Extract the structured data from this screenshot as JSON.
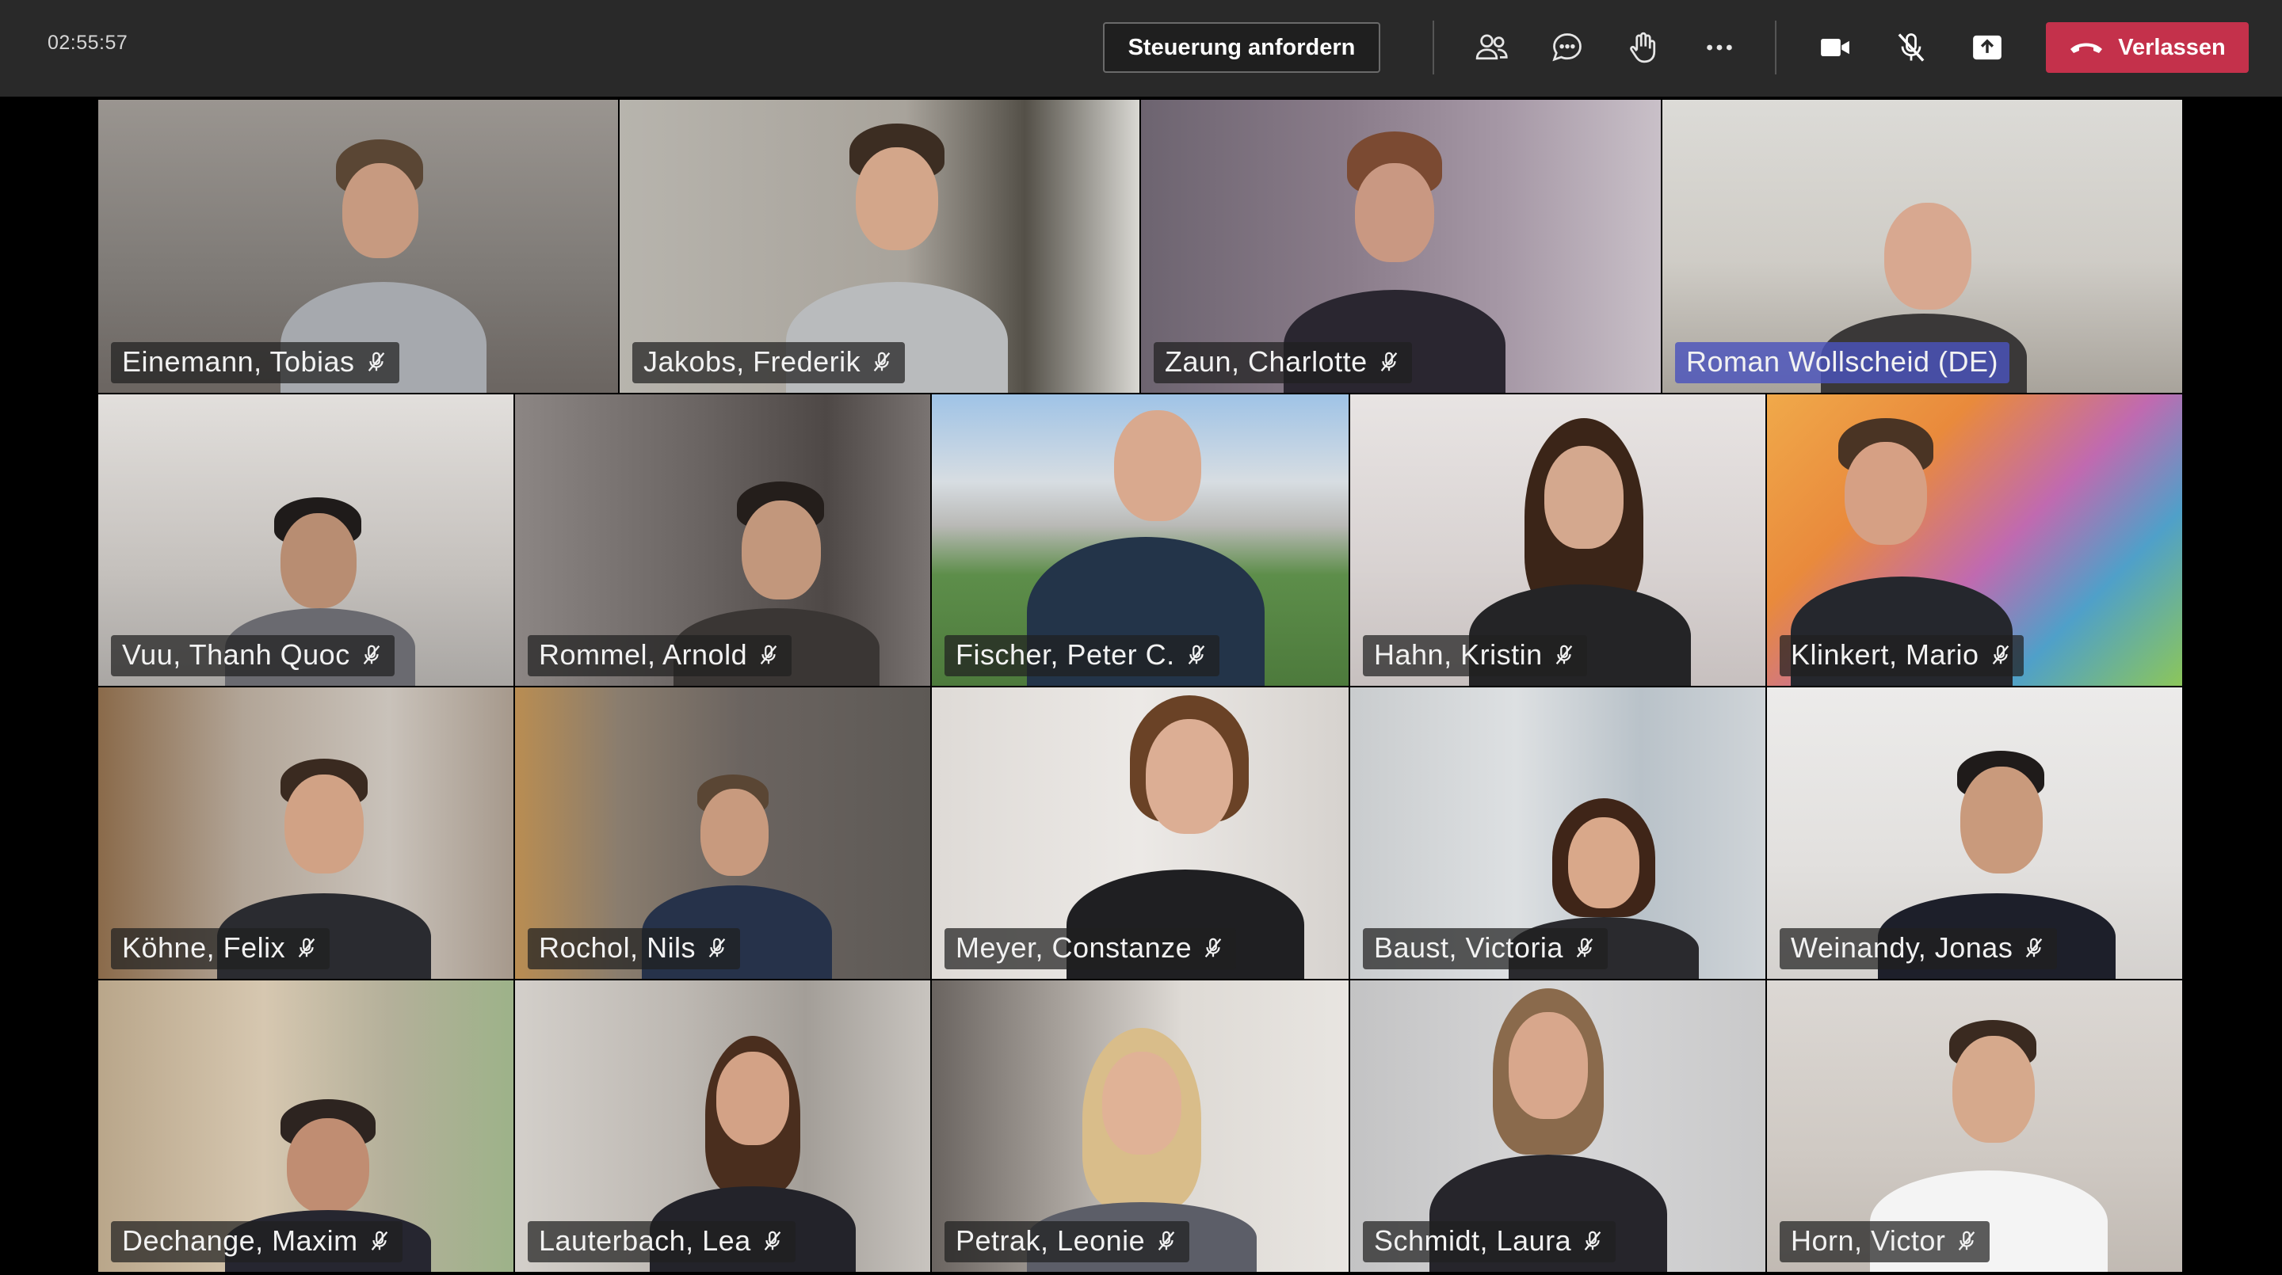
{
  "timer": "02:55:57",
  "toolbar": {
    "request_control_label": "Steuerung anfordern",
    "icons": [
      "participants-icon",
      "chat-icon",
      "raise-hand-icon",
      "more-options-icon",
      "camera-icon",
      "mic-muted-icon",
      "share-screen-icon"
    ],
    "leave_label": "Verlassen",
    "leave_color": "#c4314b"
  },
  "participants": [
    {
      "name": "Einemann, Tobias"
    },
    {
      "name": "Jakobs, Frederik"
    },
    {
      "name": "Zaun, Charlotte"
    },
    {
      "name": "Roman Wollscheid (DE)"
    },
    {
      "name": "Vuu, Thanh Quoc"
    },
    {
      "name": "Rommel, Arnold"
    },
    {
      "name": "Fischer, Peter C."
    },
    {
      "name": "Hahn, Kristin"
    },
    {
      "name": "Klinkert, Mario"
    },
    {
      "name": "Köhne, Felix"
    },
    {
      "name": "Rochol, Nils"
    },
    {
      "name": "Meyer, Constanze"
    },
    {
      "name": "Baust, Victoria"
    },
    {
      "name": "Weinandy, Jonas"
    },
    {
      "name": "Dechange, Maxim"
    },
    {
      "name": "Lauterbach, Lea"
    },
    {
      "name": "Petrak, Leonie"
    },
    {
      "name": "Schmidt, Laura"
    },
    {
      "name": "Horn, Victor"
    }
  ]
}
